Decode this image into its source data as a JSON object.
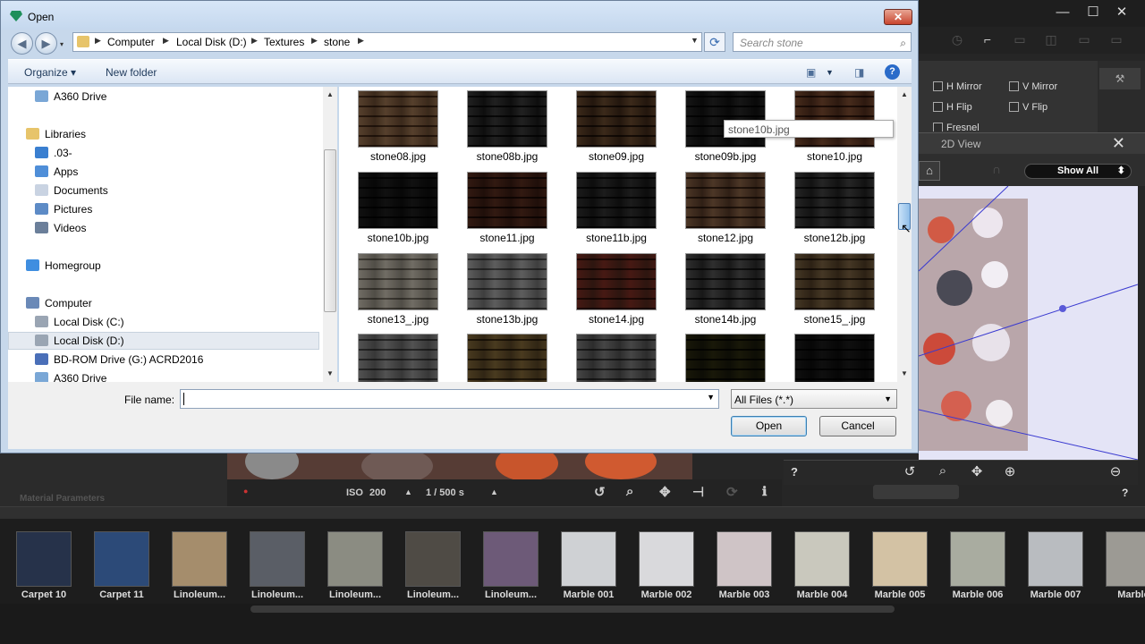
{
  "dialog": {
    "title": "Open",
    "address": [
      "Computer",
      "Local Disk (D:)",
      "Textures",
      "stone"
    ],
    "search_placeholder": "Search stone",
    "organize": "Organize",
    "organize_caret": "▾",
    "new_folder": "New folder",
    "nav": [
      {
        "label": "A360 Drive",
        "color": "#7aa7d6"
      },
      {
        "label": "Libraries",
        "color": "#e7c46a"
      },
      {
        "label": ".03-",
        "color": "#3a7fd0"
      },
      {
        "label": "Apps",
        "color": "#4f8ed8"
      },
      {
        "label": "Documents",
        "color": "#c9d3e2"
      },
      {
        "label": "Pictures",
        "color": "#5d8bc6"
      },
      {
        "label": "Videos",
        "color": "#6b7f9a"
      },
      {
        "label": "Homegroup",
        "color": "#3f8ee0"
      },
      {
        "label": "Computer",
        "color": "#6a89b7"
      },
      {
        "label": "Local Disk (C:)",
        "color": "#9aa5b3"
      },
      {
        "label": "Local Disk (D:)",
        "color": "#9aa5b3"
      },
      {
        "label": "BD-ROM Drive (G:) ACRD2016",
        "color": "#4a6fb8"
      },
      {
        "label": "A360 Drive",
        "color": "#7aa7d6"
      }
    ],
    "files": [
      {
        "name": "stone08.jpg",
        "c1": "#7a6653",
        "c2": "#b4a08a"
      },
      {
        "name": "stone08b.jpg",
        "c1": "#3c3c3c",
        "c2": "#8d8d8d"
      },
      {
        "name": "stone09.jpg",
        "c1": "#5e4c3b",
        "c2": "#a28c72"
      },
      {
        "name": "stone09b.jpg",
        "c1": "#303030",
        "c2": "#777777"
      },
      {
        "name": "stone10.jpg",
        "c1": "#6b5040",
        "c2": "#a98a6f"
      },
      {
        "name": "stone10b.jpg",
        "c1": "#2b2b2b",
        "c2": "#666666"
      },
      {
        "name": "stone11.jpg",
        "c1": "#5a3e33",
        "c2": "#8e6a58"
      },
      {
        "name": "stone11b.jpg",
        "c1": "#3a3a3a",
        "c2": "#7c7c7c"
      },
      {
        "name": "stone12.jpg",
        "c1": "#6e5a4a",
        "c2": "#b19b86"
      },
      {
        "name": "stone12b.jpg",
        "c1": "#444444",
        "c2": "#8c8c8c"
      },
      {
        "name": "stone13_.jpg",
        "c1": "#8f8c86",
        "c2": "#c9c6bf"
      },
      {
        "name": "stone13b.jpg",
        "c1": "#7e7e7e",
        "c2": "#bdbdbd"
      },
      {
        "name": "stone14.jpg",
        "c1": "#6b4a3f",
        "c2": "#a8574f"
      },
      {
        "name": "stone14b.jpg",
        "c1": "#4e4e4e",
        "c2": "#9a9a9a"
      },
      {
        "name": "stone15_.jpg",
        "c1": "#6a5c48",
        "c2": "#a79a84"
      },
      {
        "name": "",
        "c1": "#777777",
        "c2": "#b0b0b0"
      },
      {
        "name": "",
        "c1": "#6f6248",
        "c2": "#a9986f"
      },
      {
        "name": "",
        "c1": "#6a6a6a",
        "c2": "#a8a8a8"
      },
      {
        "name": "",
        "c1": "#3a3a26",
        "c2": "#6e6a3c"
      },
      {
        "name": "",
        "c1": "#2a2a2a",
        "c2": "#5c5c5c"
      }
    ],
    "tooltip": "stone10b.jpg",
    "file_name_label": "File name:",
    "file_name_value": "",
    "file_type": "All Files (*.*)",
    "open_button": "Open",
    "cancel_button": "Cancel"
  },
  "app": {
    "options": [
      "H Mirror",
      "V Mirror",
      "H Flip",
      "V Flip",
      "Fresnel"
    ],
    "view2d_title": "2D View",
    "show_all": "Show All",
    "help": "?",
    "iso_label": "ISO",
    "iso_value": "200",
    "shutter": "1 / 500 s",
    "material_params": "Material Parameters",
    "library": [
      {
        "name": "Carpet 10",
        "color": "#26324a"
      },
      {
        "name": "Carpet 11",
        "color": "#2c4a78"
      },
      {
        "name": "Linoleum...",
        "color": "#a58d6c"
      },
      {
        "name": "Linoleum...",
        "color": "#5a5e66"
      },
      {
        "name": "Linoleum...",
        "color": "#8b8c82"
      },
      {
        "name": "Linoleum...",
        "color": "#4f4b45"
      },
      {
        "name": "Linoleum...",
        "color": "#6d5a78"
      },
      {
        "name": "Marble 001",
        "color": "#cfd1d4"
      },
      {
        "name": "Marble 002",
        "color": "#d9d9dc"
      },
      {
        "name": "Marble 003",
        "color": "#cfc4c6"
      },
      {
        "name": "Marble 004",
        "color": "#c9c8bd"
      },
      {
        "name": "Marble 005",
        "color": "#d3c2a4"
      },
      {
        "name": "Marble 006",
        "color": "#a9aca0"
      },
      {
        "name": "Marble 007",
        "color": "#b9bcc0"
      },
      {
        "name": "Marble",
        "color": "#9c9a94"
      }
    ]
  }
}
